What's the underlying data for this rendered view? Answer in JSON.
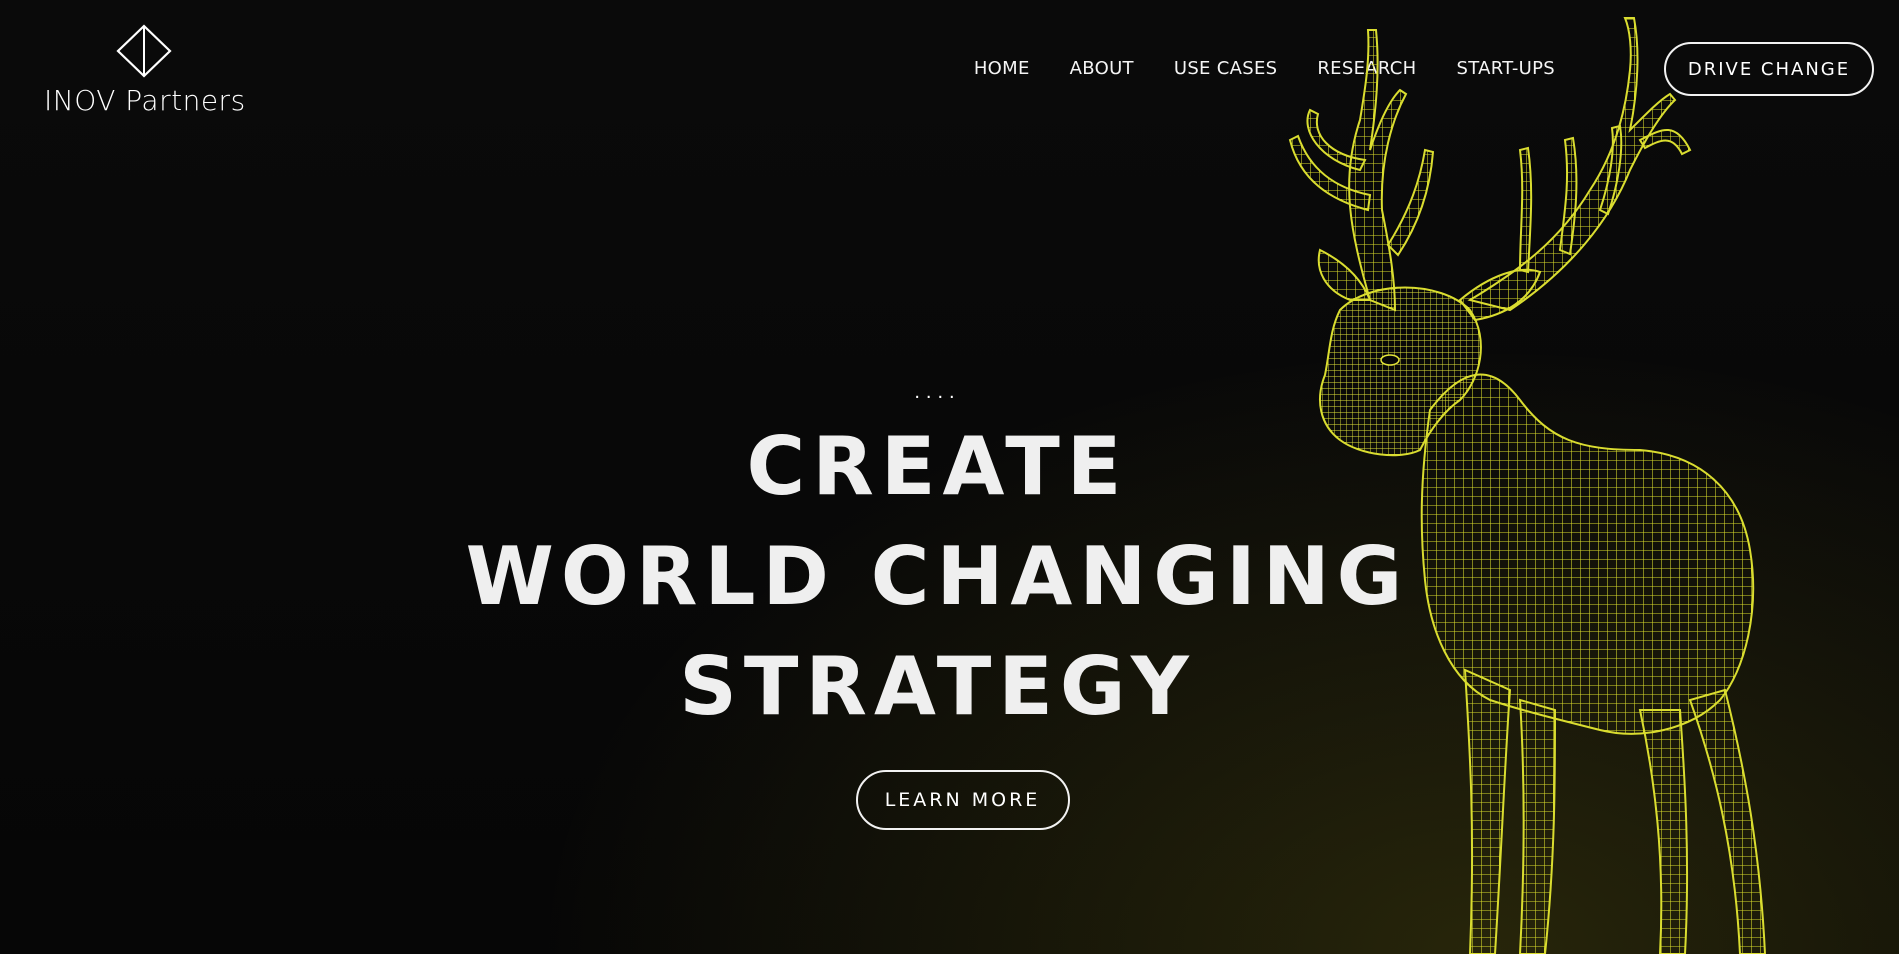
{
  "brand": {
    "logo_icon": "diamond-outline-icon",
    "name": "INOV Partners"
  },
  "nav": {
    "items": [
      {
        "label": "HOME"
      },
      {
        "label": "ABOUT"
      },
      {
        "label": "USE CASES"
      },
      {
        "label": "RESEARCH"
      },
      {
        "label": "START-UPS"
      }
    ],
    "cta_label": "DRIVE CHANGE"
  },
  "hero": {
    "dots": "....",
    "headline": [
      "CREATE",
      "WORLD CHANGING",
      "STRATEGY"
    ],
    "button_label": "LEARN MORE",
    "image": "wireframe-deer-illustration"
  },
  "colors": {
    "background": "#070707",
    "text": "#f2f2f2",
    "accent": "#d9dc2c"
  }
}
